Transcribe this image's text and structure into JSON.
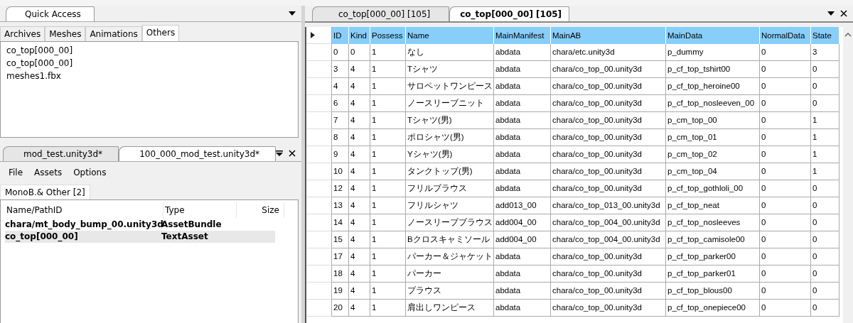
{
  "quick_access": {
    "title": "Quick Access",
    "tabs": [
      {
        "label": "Archives",
        "selected": false
      },
      {
        "label": "Meshes",
        "selected": false
      },
      {
        "label": "Animations",
        "selected": false
      },
      {
        "label": "Others",
        "selected": true
      }
    ],
    "items": [
      "co_top[000_00]",
      "co_top[000_00]",
      "meshes1.fbx"
    ]
  },
  "asset_panel": {
    "tabs": [
      {
        "label": "mod_test.unity3d*",
        "selected": false
      },
      {
        "label": "100_000_mod_test.unity3d*",
        "selected": true
      }
    ],
    "menu": [
      "File",
      "Assets",
      "Options"
    ],
    "subtab": "MonoB.& Other [2]",
    "columns": [
      "Name/PathID",
      "Type",
      "Size"
    ],
    "rows": [
      {
        "name": "chara/mt_body_bump_00.unity3d",
        "type": "AssetBundle",
        "selected": false
      },
      {
        "name": "co_top[000_00]",
        "type": "TextAsset",
        "selected": true
      }
    ]
  },
  "table": {
    "tabs": [
      {
        "label": "co_top[000_00] [105]",
        "selected": false
      },
      {
        "label": "co_top[000_00] [105]",
        "selected": true
      }
    ],
    "columns": [
      "ID",
      "Kind",
      "Possess",
      "Name",
      "MainManifest",
      "MainAB",
      "MainData",
      "NormalData",
      "State"
    ],
    "rows": [
      [
        "0",
        "0",
        "1",
        "なし",
        "abdata",
        "chara/etc.unity3d",
        "p_dummy",
        "0",
        "3"
      ],
      [
        "3",
        "4",
        "1",
        "Tシャツ",
        "abdata",
        "chara/co_top_00.unity3d",
        "p_cf_top_tshirt00",
        "0",
        "0"
      ],
      [
        "4",
        "4",
        "1",
        "サロペットワンピース",
        "abdata",
        "chara/co_top_00.unity3d",
        "p_cf_top_heroine00",
        "0",
        "0"
      ],
      [
        "6",
        "4",
        "1",
        "ノースリーブニット",
        "abdata",
        "chara/co_top_00.unity3d",
        "p_cf_top_nosleeven_00",
        "0",
        "0"
      ],
      [
        "7",
        "4",
        "1",
        "Tシャツ(男)",
        "abdata",
        "chara/co_top_00.unity3d",
        "p_cm_top_00",
        "0",
        "1"
      ],
      [
        "8",
        "4",
        "1",
        "ポロシャツ(男)",
        "abdata",
        "chara/co_top_00.unity3d",
        "p_cm_top_01",
        "0",
        "1"
      ],
      [
        "9",
        "4",
        "1",
        "Yシャツ(男)",
        "abdata",
        "chara/co_top_00.unity3d",
        "p_cm_top_02",
        "0",
        "1"
      ],
      [
        "10",
        "4",
        "1",
        "タンクトップ(男)",
        "abdata",
        "chara/co_top_00.unity3d",
        "p_cm_top_04",
        "0",
        "1"
      ],
      [
        "12",
        "4",
        "1",
        "フリルブラウス",
        "abdata",
        "chara/co_top_00.unity3d",
        "p_cf_top_gothloli_00",
        "0",
        "0"
      ],
      [
        "13",
        "4",
        "1",
        "フリルシャツ",
        "add013_00",
        "chara/co_top_013_00.unity3d",
        "p_cf_top_neat",
        "0",
        "0"
      ],
      [
        "14",
        "4",
        "1",
        "ノースリーブブラウス",
        "add004_00",
        "chara/co_top_004_00.unity3d",
        "p_cf_top_nosleeves",
        "0",
        "0"
      ],
      [
        "15",
        "4",
        "1",
        "Bクロスキャミソール",
        "add004_00",
        "chara/co_top_004_00.unity3d",
        "p_cf_top_camisole00",
        "0",
        "0"
      ],
      [
        "17",
        "4",
        "1",
        "パーカー＆ジャケット",
        "abdata",
        "chara/co_top_00.unity3d",
        "p_cf_top_parker00",
        "0",
        "0"
      ],
      [
        "18",
        "4",
        "1",
        "パーカー",
        "abdata",
        "chara/co_top_00.unity3d",
        "p_cf_top_parker01",
        "0",
        "0"
      ],
      [
        "19",
        "4",
        "1",
        "ブラウス",
        "abdata",
        "chara/co_top_00.unity3d",
        "p_cf_top_blous00",
        "0",
        "0"
      ],
      [
        "20",
        "4",
        "1",
        "肩出しワンピース",
        "abdata",
        "chara/co_top_00.unity3d",
        "p_cf_top_onepiece00",
        "0",
        "0"
      ]
    ]
  }
}
